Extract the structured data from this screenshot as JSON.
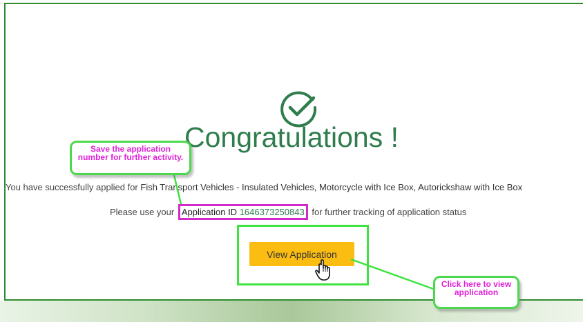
{
  "page": {
    "title": "Congratulations !",
    "success_text": "You have successfully applied for",
    "success_services": "Fish Transport Vehicles - Insulated Vehicles, Motorcycle with Ice Box, Autorickshaw with Ice Box",
    "instruction_prefix": "Please use your",
    "app_id_label": "Application ID",
    "app_id_number": "1646373250843",
    "instruction_suffix": "for further tracking of application status",
    "view_button_label": "View Application"
  },
  "callouts": {
    "save_note": "Save the application number for further activity.",
    "click_note": "Click here to view application"
  },
  "colors": {
    "accent_green": "#2f7d4c",
    "button_yellow": "#fbbd12",
    "highlight_magenta": "#d12cc8",
    "highlight_green": "#3fe23f"
  },
  "icons": {
    "success": "check-circle-icon",
    "pointer": "hand-pointer-icon"
  }
}
